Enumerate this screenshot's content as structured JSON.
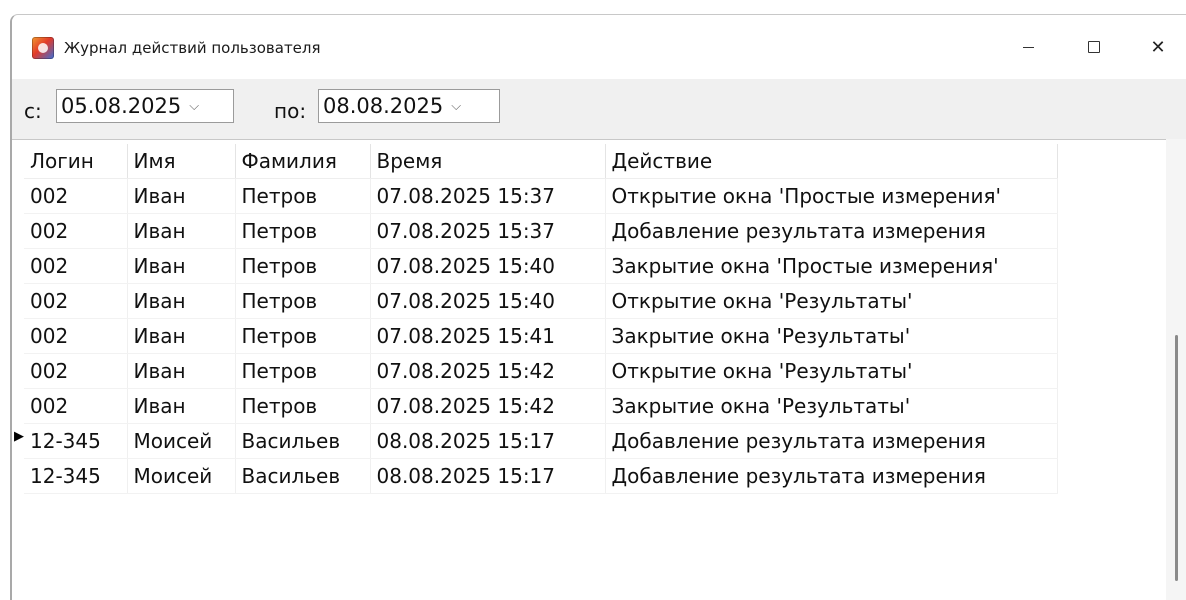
{
  "window": {
    "title": "Журнал действий пользователя",
    "icon": "app-icon"
  },
  "filters": {
    "from_label": "с:",
    "from_value": "05.08.2025",
    "to_label": "по:",
    "to_value": "08.08.2025",
    "chevron_glyph": "⌵"
  },
  "table": {
    "columns": [
      "Логин",
      "Имя",
      "Фамилия",
      "Время",
      "Действие"
    ],
    "current_row_index": 7,
    "rows": [
      [
        "002",
        "Иван",
        "Петров",
        "07.08.2025 15:37",
        "Открытие окна 'Простые измерения'"
      ],
      [
        "002",
        "Иван",
        "Петров",
        "07.08.2025 15:37",
        "Добавление результата измерения"
      ],
      [
        "002",
        "Иван",
        "Петров",
        "07.08.2025 15:40",
        "Закрытие окна 'Простые измерения'"
      ],
      [
        "002",
        "Иван",
        "Петров",
        "07.08.2025 15:40",
        "Открытие окна 'Результаты'"
      ],
      [
        "002",
        "Иван",
        "Петров",
        "07.08.2025 15:41",
        "Закрытие окна 'Результаты'"
      ],
      [
        "002",
        "Иван",
        "Петров",
        "07.08.2025 15:42",
        "Открытие окна 'Результаты'"
      ],
      [
        "002",
        "Иван",
        "Петров",
        "07.08.2025 15:42",
        "Закрытие окна 'Результаты'"
      ],
      [
        "12-345",
        "Моисей",
        "Васильев",
        "08.08.2025 15:17",
        "Добавление результата измерения"
      ],
      [
        "12-345",
        "Моисей",
        "Васильев",
        "08.08.2025 15:17",
        "Добавление результата измерения"
      ]
    ]
  },
  "colors": {
    "window_bg": "#f0f0f0",
    "grid_bg": "#ffffff",
    "text": "#111111"
  }
}
